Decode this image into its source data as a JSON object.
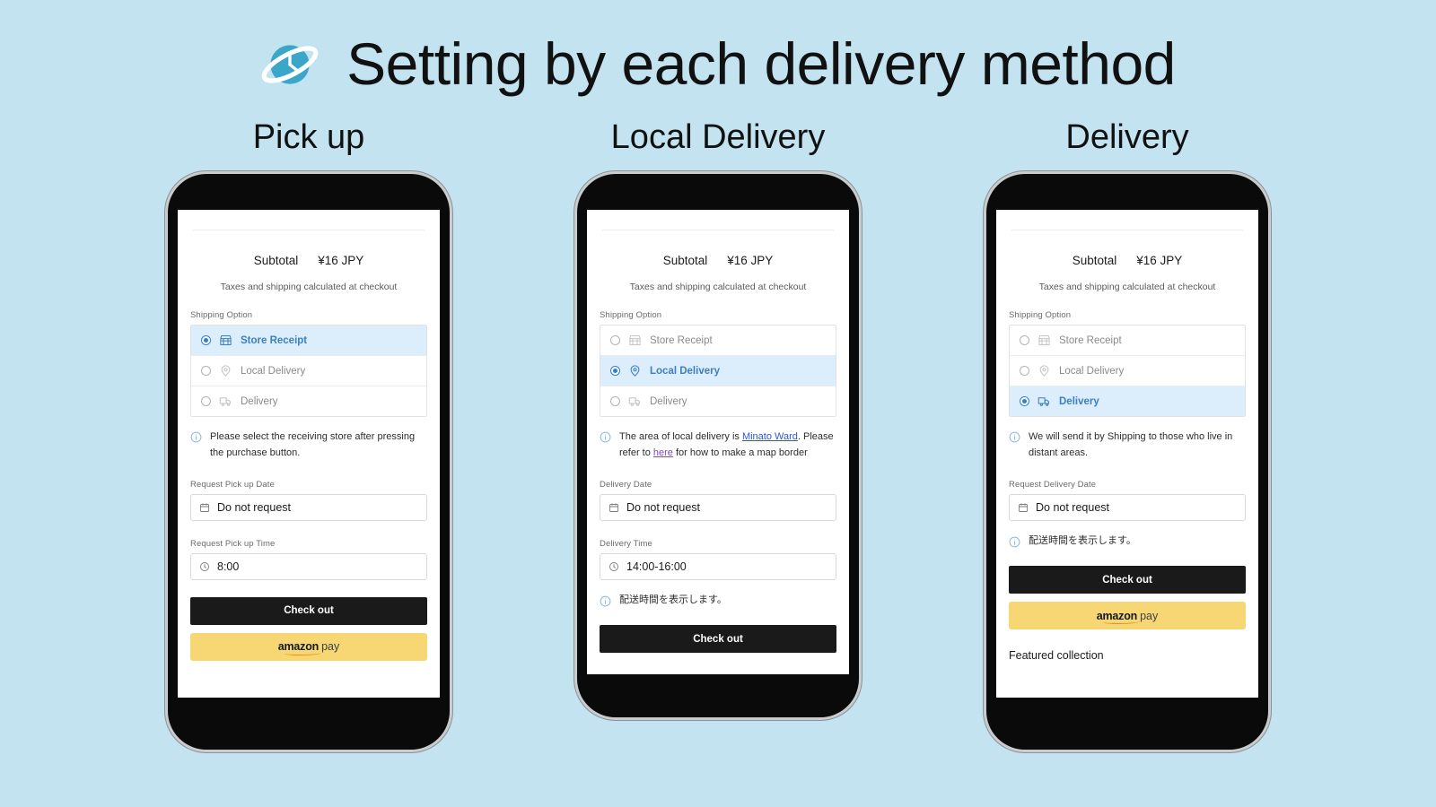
{
  "header": {
    "title": "Setting by each delivery method",
    "logo_icon": "planet-clock-icon",
    "background_color": "#c2e3ef"
  },
  "shared": {
    "subtotal_label": "Subtotal",
    "subtotal_value": "¥16 JPY",
    "taxes_note": "Taxes and shipping calculated at checkout",
    "shipping_option_label": "Shipping Option",
    "checkout_label": "Check out",
    "amazon_pay": {
      "word1": "amazon",
      "word2": "pay"
    },
    "options": {
      "store_receipt": "Store Receipt",
      "local_delivery": "Local Delivery",
      "delivery": "Delivery"
    },
    "do_not_request": "Do not request",
    "accent_selected_bg": "#dceefb",
    "accent_selected_text": "#3d7fc0",
    "amazon_bg": "#f7d774"
  },
  "columns": [
    {
      "title": "Pick up",
      "selected_option": "store_receipt",
      "info_note": "Please select the receiving store after pressing the purchase button.",
      "fields": [
        {
          "label": "Request Pick up Date",
          "value": "Do not request",
          "icon": "calendar-icon"
        },
        {
          "label": "Request Pick up Time",
          "value": "8:00",
          "icon": "clock-icon"
        }
      ],
      "has_amazon_pay": true,
      "featured_collection": null
    },
    {
      "title": "Local Delivery",
      "selected_option": "local_delivery",
      "info_note_parts": {
        "p1": "The area of local delivery is ",
        "link1": "Minato Ward",
        "p2": ". Please refer to ",
        "link2": "here",
        "p3": " for how to make a map border"
      },
      "fields": [
        {
          "label": "Delivery Date",
          "value": "Do not request",
          "icon": "calendar-icon"
        },
        {
          "label": "Delivery Time",
          "value": "14:00-16:00",
          "icon": "clock-icon"
        }
      ],
      "footer_note": "配送時間を表示します。",
      "has_amazon_pay": false,
      "featured_collection": null
    },
    {
      "title": "Delivery",
      "selected_option": "delivery",
      "info_note": "We will send it by Shipping to those who live in distant areas.",
      "fields": [
        {
          "label": "Request Delivery Date",
          "value": "Do not request",
          "icon": "calendar-icon"
        }
      ],
      "footer_note": "配送時間を表示します。",
      "has_amazon_pay": true,
      "featured_collection": "Featured collection"
    }
  ]
}
